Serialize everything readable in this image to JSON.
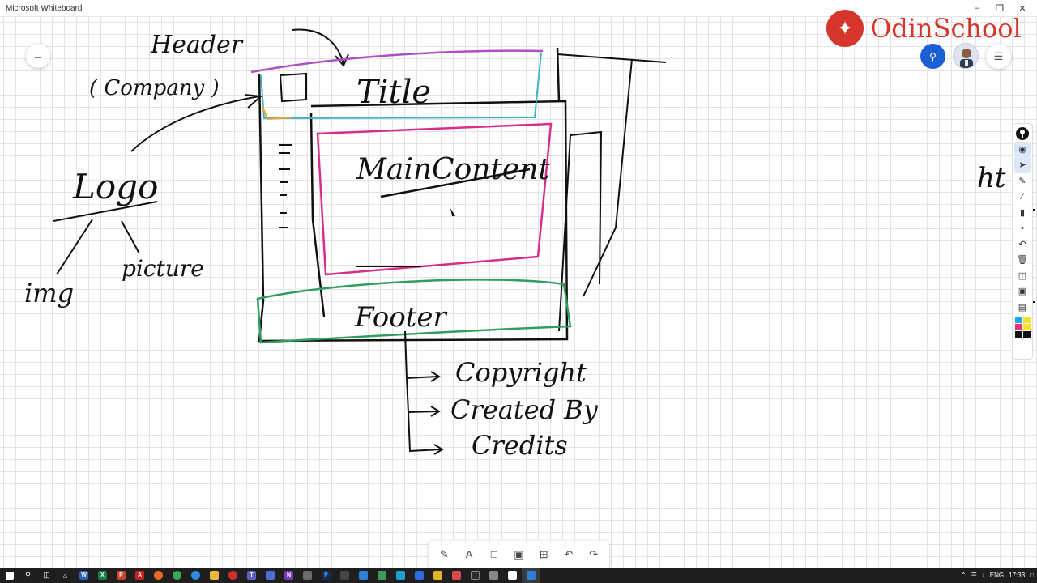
{
  "window": {
    "title": "Microsoft Whiteboard",
    "minimize_icon": "minimize-icon",
    "restore_icon": "restore-icon",
    "close_icon": "close-icon"
  },
  "brand": {
    "name": "OdinSchool"
  },
  "sketch": {
    "header_label": "Header",
    "company_label": "( Company )",
    "title_label": "Title",
    "logo_label": "Logo",
    "img_label": "img",
    "picture_label": "picture",
    "main_content_label": "MainContent",
    "footer_label": "Footer",
    "footer_items": [
      "Copyright",
      "Created By",
      "Credits"
    ],
    "partial_label": "ht",
    "colors": {
      "ink": "#111111",
      "header_outline": "#b04fc4",
      "header_inner": "#3fb3c6",
      "logo_box": "#f0a53a",
      "main_outline": "#d62f8b",
      "footer_outline": "#2f9e5e"
    }
  },
  "right_toolbar": {
    "tools": [
      "ruler-toggle-icon",
      "eye-icon",
      "select-icon",
      "pen-icon",
      "pencil-icon",
      "highlighter-icon",
      "dot-icon",
      "undo-icon",
      "delete-icon",
      "stamp-icon",
      "image-icon",
      "note-icon"
    ],
    "swatch_colors": [
      "#1ea7f0",
      "#f5e02a",
      "#e8317d",
      "#f5e02a",
      "#111111",
      "#111111"
    ]
  },
  "bottom_toolbar": {
    "tools": [
      "ink-tool-icon",
      "text-icon",
      "note-icon",
      "image-icon",
      "add-icon",
      "undo-icon",
      "redo-icon"
    ],
    "text_tool_glyph": "A"
  },
  "taskbar": {
    "language": "ENG",
    "time": "17:33"
  }
}
